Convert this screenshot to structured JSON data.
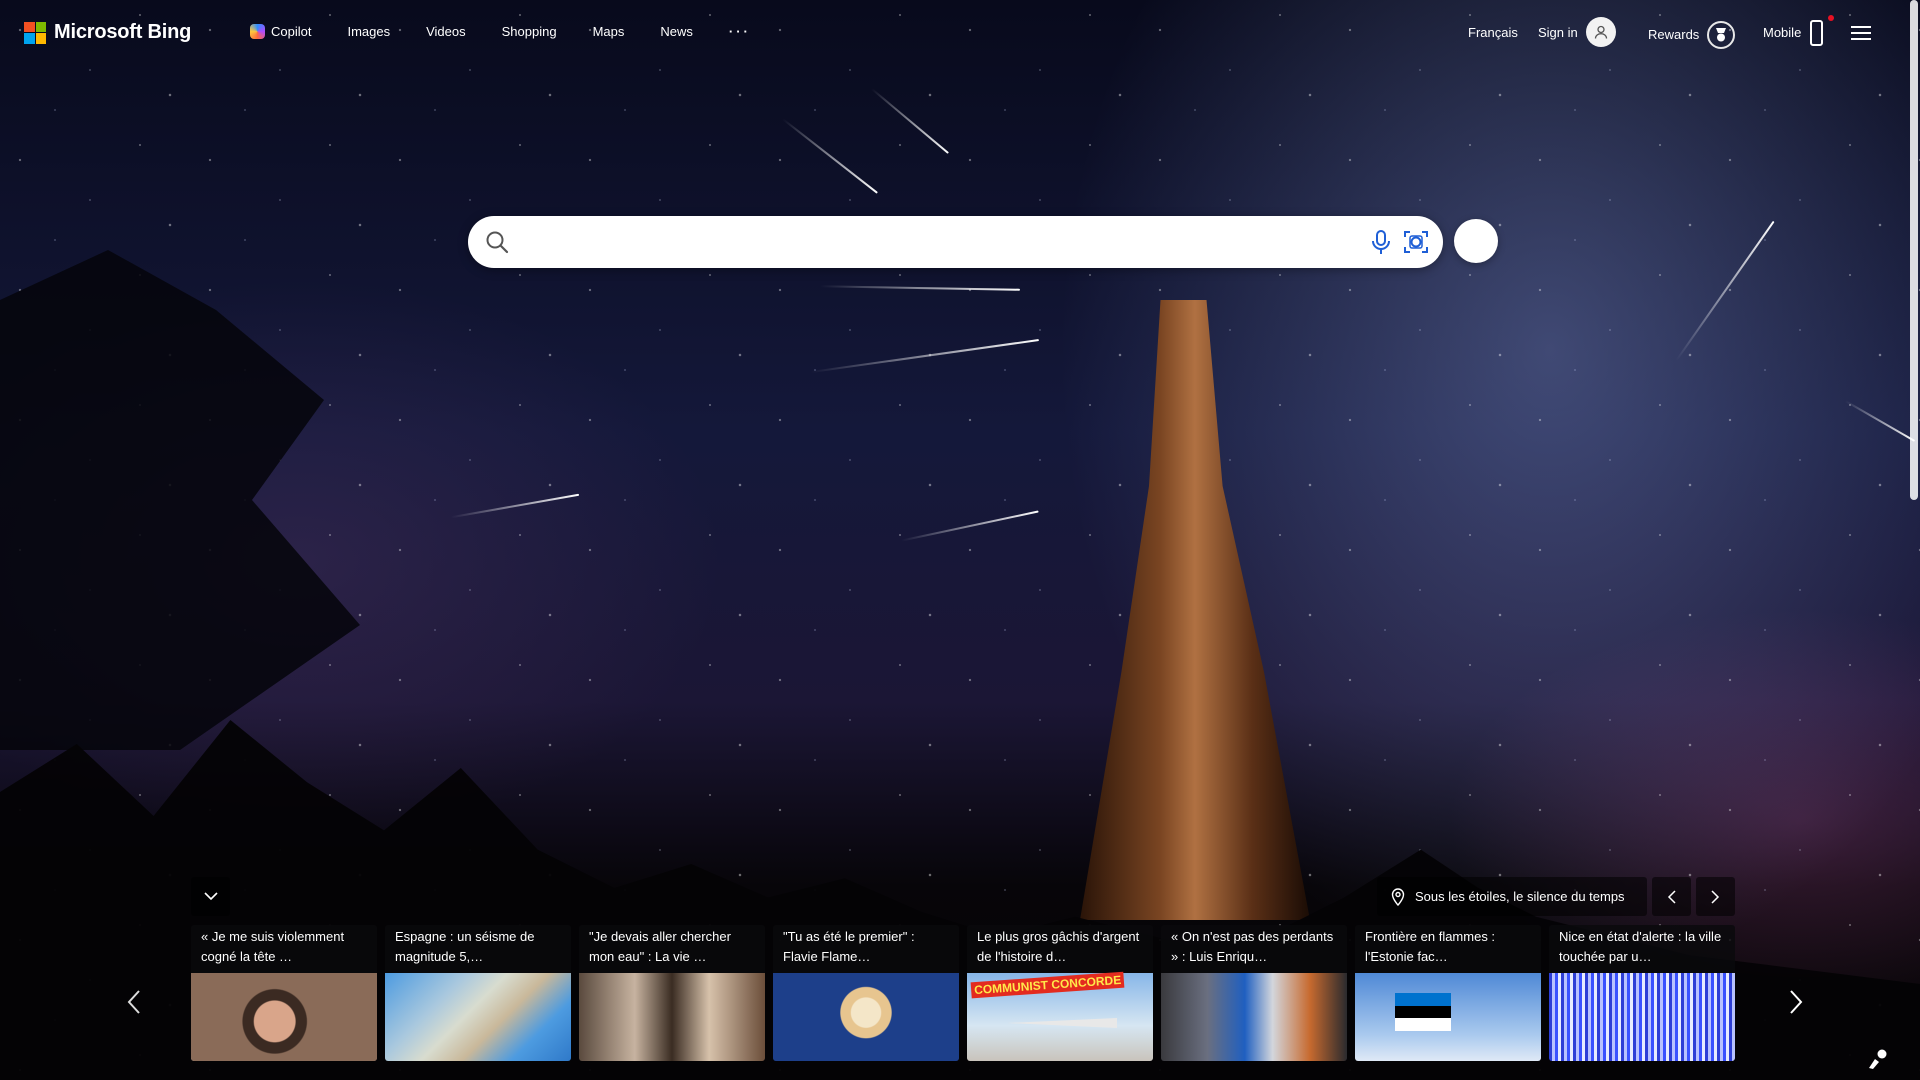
{
  "app": {
    "name": "Microsoft Bing"
  },
  "header": {
    "nav": [
      {
        "label": "Copilot",
        "icon": "copilot-icon"
      },
      {
        "label": "Images"
      },
      {
        "label": "Videos"
      },
      {
        "label": "Shopping"
      },
      {
        "label": "Maps"
      },
      {
        "label": "News"
      },
      {
        "label": "···"
      }
    ],
    "language": "Français",
    "sign_in": "Sign in",
    "rewards": "Rewards",
    "mobile": "Mobile"
  },
  "search": {
    "placeholder": "",
    "value": ""
  },
  "image_info": {
    "title": "Sous les étoiles, le silence du temps"
  },
  "news": [
    {
      "caption": "« Je me suis violemment cogné la tête …"
    },
    {
      "caption": "Espagne : un séisme de magnitude 5,…"
    },
    {
      "caption": "\"Je devais aller chercher mon eau\" : La vie …"
    },
    {
      "caption": "\"Tu as été le premier\" : Flavie Flame…"
    },
    {
      "caption": "Le plus gros gâchis d'argent de l'histoire d…",
      "badge": "COMMUNIST CONCORDE"
    },
    {
      "caption": "« On n'est pas des perdants » : Luis Enriqu…"
    },
    {
      "caption": "Frontière en flammes : l'Estonie fac…"
    },
    {
      "caption": "Nice en état d'alerte : la ville touchée par u…"
    }
  ],
  "colors": {
    "ms_red": "#f25022",
    "ms_green": "#7fba00",
    "ms_blue": "#00a4ef",
    "ms_yellow": "#ffb900",
    "notification": "#e81123"
  }
}
